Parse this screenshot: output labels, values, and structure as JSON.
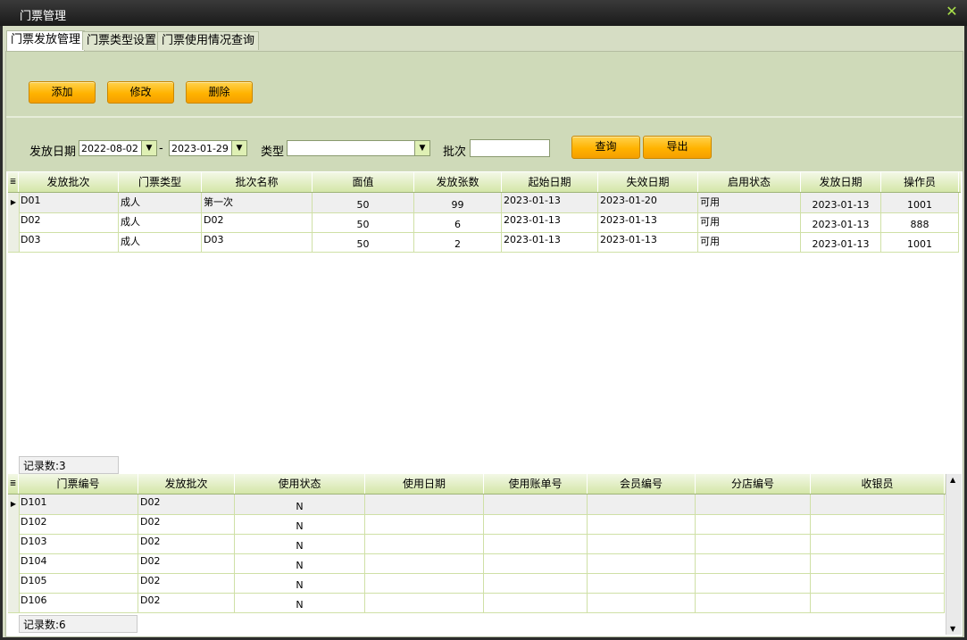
{
  "window": {
    "title": "门票管理",
    "close": "✕"
  },
  "tabs": [
    "门票发放管理",
    "门票类型设置",
    "门票使用情况查询"
  ],
  "toolbar": {
    "add": "添加",
    "edit": "修改",
    "delete": "删除"
  },
  "filter": {
    "date_label": "发放日期",
    "date_from": "2022-08-02",
    "date_to": "2023-01-29",
    "sep": "-",
    "type_label": "类型",
    "type_value": "",
    "batch_label": "批次",
    "batch_value": "",
    "query": "查询",
    "export": "导出"
  },
  "grid1": {
    "headers": [
      "发放批次",
      "门票类型",
      "批次名称",
      "面值",
      "发放张数",
      "起始日期",
      "失效日期",
      "启用状态",
      "发放日期",
      "操作员"
    ],
    "rows": [
      [
        "D01",
        "成人",
        "第一次",
        "50",
        "99",
        "2023-01-13",
        "2023-01-20",
        "可用",
        "2023-01-13",
        "1001"
      ],
      [
        "D02",
        "成人",
        "D02",
        "50",
        "6",
        "2023-01-13",
        "2023-01-13",
        "可用",
        "2023-01-13",
        "888"
      ],
      [
        "D03",
        "成人",
        "D03",
        "50",
        "2",
        "2023-01-13",
        "2023-01-13",
        "可用",
        "2023-01-13",
        "1001"
      ]
    ],
    "status": "记录数:3"
  },
  "grid2": {
    "headers": [
      "门票编号",
      "发放批次",
      "使用状态",
      "使用日期",
      "使用账单号",
      "会员编号",
      "分店编号",
      "收银员"
    ],
    "rows": [
      [
        "D101",
        "D02",
        "N",
        "",
        "",
        "",
        "",
        ""
      ],
      [
        "D102",
        "D02",
        "N",
        "",
        "",
        "",
        "",
        ""
      ],
      [
        "D103",
        "D02",
        "N",
        "",
        "",
        "",
        "",
        ""
      ],
      [
        "D104",
        "D02",
        "N",
        "",
        "",
        "",
        "",
        ""
      ],
      [
        "D105",
        "D02",
        "N",
        "",
        "",
        "",
        "",
        ""
      ],
      [
        "D106",
        "D02",
        "N",
        "",
        "",
        "",
        "",
        ""
      ]
    ],
    "status": "记录数:6"
  },
  "colors": {
    "accent": "#ffb300",
    "panel": "#cfdab9",
    "header": "#d4e6a8"
  }
}
